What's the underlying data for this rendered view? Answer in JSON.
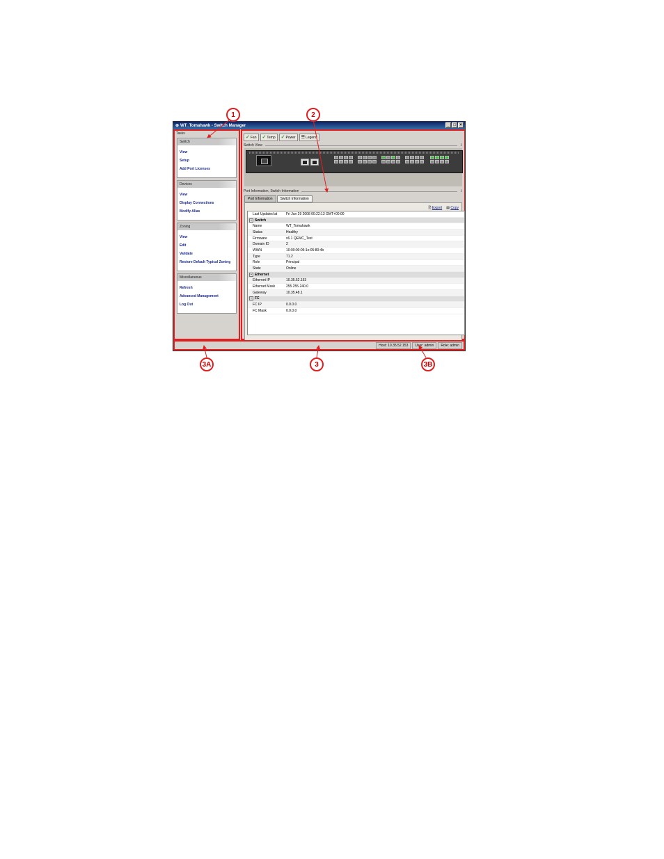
{
  "window": {
    "title": "WT_Tomahawk - Switch Manager",
    "controls": [
      "_",
      "□",
      "×"
    ]
  },
  "callouts": {
    "c1": "1",
    "c2": "2",
    "c3": "3",
    "c3a": "3A",
    "c3b": "3B"
  },
  "tasks": {
    "label": "Tasks",
    "groups": [
      {
        "title": "Switch",
        "items": [
          "View",
          "Setup",
          "Add Port Licenses"
        ]
      },
      {
        "title": "Devices",
        "items": [
          "View",
          "Display Connections",
          "Modify Alias"
        ]
      },
      {
        "title": "Zoning",
        "items": [
          "View",
          "Edit",
          "Validate",
          "Restore Default Typical Zoning"
        ]
      },
      {
        "title": "Miscellaneous",
        "items": [
          "Refresh",
          "Advanced Management",
          "Log Out"
        ]
      }
    ]
  },
  "toolbar": {
    "fan": "Fan",
    "temp": "Temp",
    "power": "Power",
    "legend": "Legend"
  },
  "switch_view": {
    "label": "Switch View",
    "pin": "⇩"
  },
  "info": {
    "label": "Port Information, Switch Information",
    "pin": "⇩",
    "tabs": [
      "Port Information",
      "Switch Information"
    ],
    "export": "Export",
    "copy": "Copy",
    "last_updated": {
      "key": "Last Updated at",
      "value": "Fri Jun 29 2008 00:22:13 GMT+00:00"
    },
    "switch_header": "Switch",
    "switch_rows": [
      {
        "key": "Name",
        "value": "WT_Tomahawk"
      },
      {
        "key": "Status",
        "value": "Healthy"
      },
      {
        "key": "Firmware",
        "value": "v6.1 QEMC_Test"
      },
      {
        "key": "Domain ID",
        "value": "2"
      },
      {
        "key": "WWN",
        "value": "10:00:00:05:1e:05:80:4b"
      },
      {
        "key": "Type",
        "value": "71.2"
      },
      {
        "key": "Role",
        "value": "Principal"
      },
      {
        "key": "State",
        "value": "Online"
      }
    ],
    "ethernet_header": "Ethernet",
    "ethernet_rows": [
      {
        "key": "Ethernet IP",
        "value": "10.35.52.153"
      },
      {
        "key": "Ethernet Mask",
        "value": "255.255.240.0"
      },
      {
        "key": "Gateway",
        "value": "10.35.48.1"
      }
    ],
    "fc_header": "FC",
    "fc_rows": [
      {
        "key": "FC IP",
        "value": "0.0.0.0"
      },
      {
        "key": "FC Mask",
        "value": "0.0.0.0"
      }
    ]
  },
  "statusbar": {
    "host": "Host: 10.35.52.153",
    "user": "User: admin",
    "role": "Role: admin"
  },
  "colors": {
    "callout": "#e02020",
    "link": "#1a2a8a",
    "titlebar": "#0a246a"
  }
}
